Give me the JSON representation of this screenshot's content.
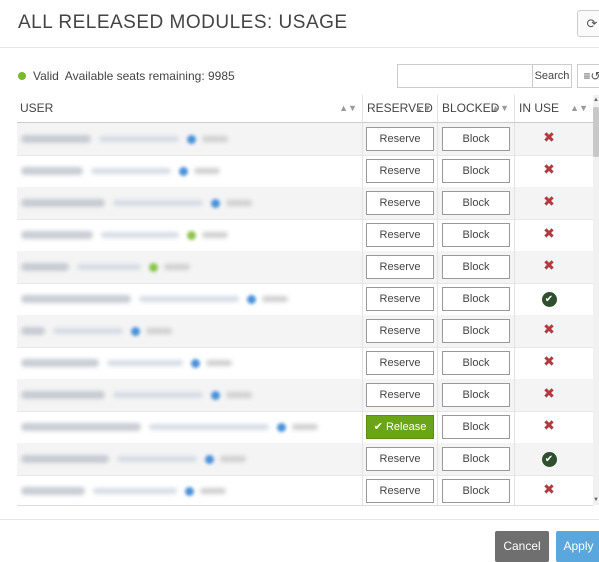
{
  "header": {
    "title": "ALL RELEASED MODULES: USAGE",
    "refresh_icon": "refresh-icon"
  },
  "status": {
    "state": "Valid",
    "state_color": "#7ab82e",
    "seats_text": "Available seats remaining: 9985"
  },
  "search": {
    "value": "",
    "placeholder": "",
    "button_label": "Search",
    "filter_icon": "filter-reset-icon"
  },
  "table": {
    "columns": [
      "USER",
      "RESERVED",
      "BLOCKED",
      "IN USE"
    ],
    "rows": [
      {
        "user": "",
        "status_color": "#4a90d9",
        "reserved_label": "Reserve",
        "reserved_active": false,
        "blocked_label": "Block",
        "in_use": false
      },
      {
        "user": "",
        "status_color": "#4a90d9",
        "reserved_label": "Reserve",
        "reserved_active": false,
        "blocked_label": "Block",
        "in_use": false
      },
      {
        "user": "",
        "status_color": "#4a90d9",
        "reserved_label": "Reserve",
        "reserved_active": false,
        "blocked_label": "Block",
        "in_use": false
      },
      {
        "user": "",
        "status_color": "#8bc34a",
        "reserved_label": "Reserve",
        "reserved_active": false,
        "blocked_label": "Block",
        "in_use": false
      },
      {
        "user": "",
        "status_color": "#8bc34a",
        "reserved_label": "Reserve",
        "reserved_active": false,
        "blocked_label": "Block",
        "in_use": false
      },
      {
        "user": "",
        "status_color": "#4a90d9",
        "reserved_label": "Reserve",
        "reserved_active": false,
        "blocked_label": "Block",
        "in_use": true
      },
      {
        "user": "",
        "status_color": "#4a90d9",
        "reserved_label": "Reserve",
        "reserved_active": false,
        "blocked_label": "Block",
        "in_use": false
      },
      {
        "user": "",
        "status_color": "#4a90d9",
        "reserved_label": "Reserve",
        "reserved_active": false,
        "blocked_label": "Block",
        "in_use": false
      },
      {
        "user": "",
        "status_color": "#4a90d9",
        "reserved_label": "Reserve",
        "reserved_active": false,
        "blocked_label": "Block",
        "in_use": false
      },
      {
        "user": "",
        "status_color": "#4a90d9",
        "reserved_label": "Release",
        "reserved_active": true,
        "blocked_label": "Block",
        "in_use": false
      },
      {
        "user": "",
        "status_color": "#4a90d9",
        "reserved_label": "Reserve",
        "reserved_active": false,
        "blocked_label": "Block",
        "in_use": true
      },
      {
        "user": "",
        "status_color": "#4a90d9",
        "reserved_label": "Reserve",
        "reserved_active": false,
        "blocked_label": "Block",
        "in_use": false
      }
    ]
  },
  "footer": {
    "cancel_label": "Cancel",
    "apply_label": "Apply"
  },
  "colors": {
    "release_button": "#6aa517",
    "cancel_button": "#6f6f6f",
    "apply_button": "#5aa7dd",
    "not_in_use": "#b23a3a",
    "in_use": "#2f4f2f"
  }
}
